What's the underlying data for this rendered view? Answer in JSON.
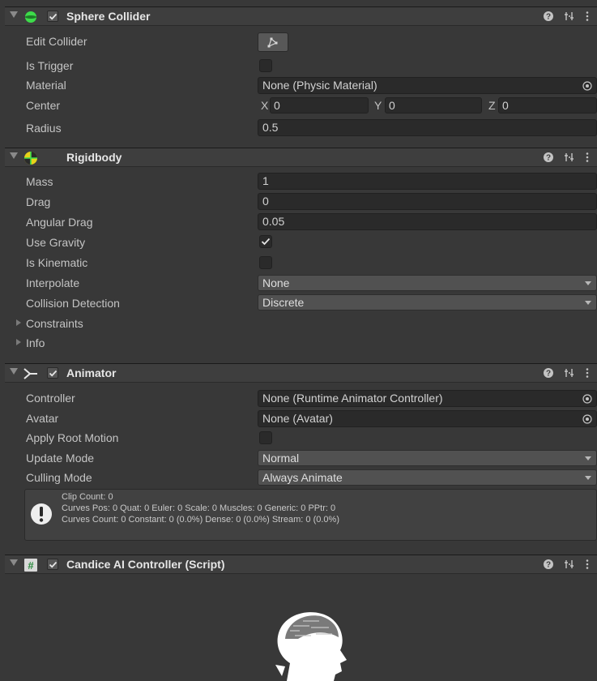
{
  "sphere_collider": {
    "title": "Sphere Collider",
    "enabled": true,
    "edit_collider_label": "Edit Collider",
    "is_trigger_label": "Is Trigger",
    "is_trigger": false,
    "material_label": "Material",
    "material_value": "None (Physic Material)",
    "center_label": "Center",
    "center": {
      "x_label": "X",
      "x": "0",
      "y_label": "Y",
      "y": "0",
      "z_label": "Z",
      "z": "0"
    },
    "radius_label": "Radius",
    "radius": "0.5"
  },
  "rigidbody": {
    "title": "Rigidbody",
    "mass_label": "Mass",
    "mass": "1",
    "drag_label": "Drag",
    "drag": "0",
    "angular_drag_label": "Angular Drag",
    "angular_drag": "0.05",
    "use_gravity_label": "Use Gravity",
    "use_gravity": true,
    "is_kinematic_label": "Is Kinematic",
    "is_kinematic": false,
    "interpolate_label": "Interpolate",
    "interpolate": "None",
    "collision_detection_label": "Collision Detection",
    "collision_detection": "Discrete",
    "constraints_label": "Constraints",
    "info_label": "Info"
  },
  "animator": {
    "title": "Animator",
    "enabled": true,
    "controller_label": "Controller",
    "controller": "None (Runtime Animator Controller)",
    "avatar_label": "Avatar",
    "avatar": "None (Avatar)",
    "apply_root_motion_label": "Apply Root Motion",
    "apply_root_motion": false,
    "update_mode_label": "Update Mode",
    "update_mode": "Normal",
    "culling_mode_label": "Culling Mode",
    "culling_mode": "Always Animate",
    "info_lines": [
      "Clip Count: 0",
      "Curves Pos: 0 Quat: 0 Euler: 0 Scale: 0 Muscles: 0 Generic: 0 PPtr: 0",
      "Curves Count: 0 Constant: 0 (0.0%) Dense: 0 (0.0%) Stream: 0 (0.0%)"
    ]
  },
  "script_component": {
    "title": "Candice AI Controller (Script)",
    "enabled": true
  },
  "colors": {
    "background": "#383838",
    "header": "#3e3e3e",
    "field": "#2a2a2a",
    "dropdown": "#515151",
    "collider_green": "#3ddc4a",
    "rigidbody_yellow": "#e8d21a"
  }
}
